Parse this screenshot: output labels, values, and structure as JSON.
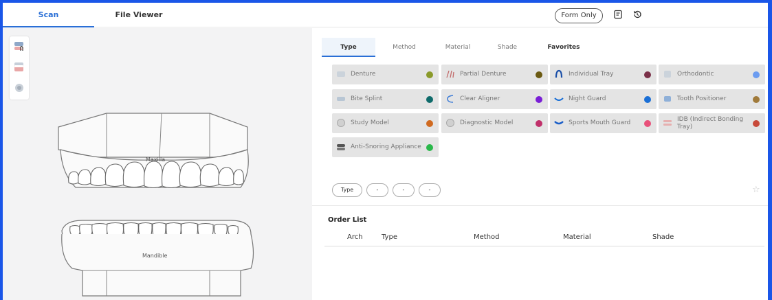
{
  "topbar": {
    "tabs": [
      {
        "label": "Scan",
        "active": true
      },
      {
        "label": "File Viewer",
        "active": false
      }
    ],
    "form_only_label": "Form Only",
    "icons": [
      "form-icon",
      "history-icon"
    ]
  },
  "left": {
    "tools": [
      "upper-jaw-tool-icon",
      "lower-jaw-tool-icon",
      "bite-tool-icon"
    ],
    "maxilla_label": "Maxilla",
    "mandible_label": "Mandible"
  },
  "main_tabs": [
    "Type",
    "Method",
    "Material",
    "Shade",
    "Favorites"
  ],
  "active_tab": "Type",
  "types": [
    {
      "label": "Denture",
      "color": "#8a9a2a"
    },
    {
      "label": "Partial Denture",
      "color": "#6b5a12"
    },
    {
      "label": "Individual Tray",
      "color": "#7a3048"
    },
    {
      "label": "Orthodontic",
      "color": "#6c9cf0"
    },
    {
      "label": "Bite Splint",
      "color": "#0f6b6b"
    },
    {
      "label": "Clear Aligner",
      "color": "#7a1fd6"
    },
    {
      "label": "Night Guard",
      "color": "#1a6fd6"
    },
    {
      "label": "Tooth Positioner",
      "color": "#a07a3a"
    },
    {
      "label": "Study Model",
      "color": "#d06a20"
    },
    {
      "label": "Diagnostic Model",
      "color": "#c0306a"
    },
    {
      "label": "Sports Mouth Guard",
      "color": "#e8507a"
    },
    {
      "label": "IDB (Indirect Bonding Tray)",
      "color": "#c84a3a"
    },
    {
      "label": "Anti-Snoring Appliance",
      "color": "#2ab84a"
    }
  ],
  "filter_pills": [
    "Type",
    "-",
    "-",
    "-"
  ],
  "order_list": {
    "title": "Order List",
    "columns": [
      "Arch",
      "Type",
      "Method",
      "Material",
      "Shade"
    ]
  }
}
